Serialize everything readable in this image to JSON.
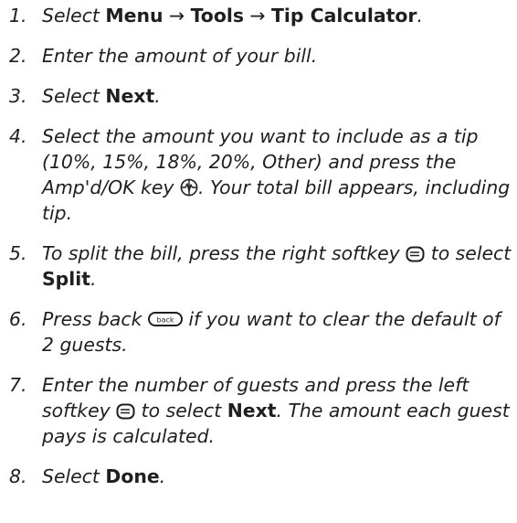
{
  "steps": [
    {
      "num": "1.",
      "parts": {
        "a": "Select ",
        "b1": "Menu",
        "arrow1": " → ",
        "b2": "Tools",
        "arrow2": " → ",
        "b3": "Tip Calculator",
        "end": "."
      }
    },
    {
      "num": "2.",
      "text": "Enter the amount of your bill."
    },
    {
      "num": "3.",
      "parts": {
        "a": "Select ",
        "b1": "Next",
        "end": "."
      }
    },
    {
      "num": "4.",
      "parts": {
        "a": "Select the amount you want to include as a tip (10%, 15%, 18%, 20%, Other) and press the Amp'd/OK key ",
        "end": ". Your total bill appears, including tip."
      }
    },
    {
      "num": "5.",
      "parts": {
        "a": "To split the bill, press the right softkey ",
        "mid": " to select ",
        "b1": "Split",
        "end": "."
      }
    },
    {
      "num": "6.",
      "parts": {
        "a": "Press back ",
        "end": " if you want to clear the default of 2 guests."
      }
    },
    {
      "num": "7.",
      "parts": {
        "a": "Enter the number of guests and press the left softkey ",
        "mid": " to select ",
        "b1": "Next",
        "end": ". The amount each guest pays is calculated."
      }
    },
    {
      "num": "8.",
      "parts": {
        "a": "Select ",
        "b1": "Done",
        "end": "."
      }
    }
  ],
  "icons": {
    "ok_key": "amp-ok-key-icon",
    "right_softkey": "right-softkey-icon",
    "back_key": "back-key-icon",
    "back_key_label": "back",
    "left_softkey": "left-softkey-icon"
  }
}
